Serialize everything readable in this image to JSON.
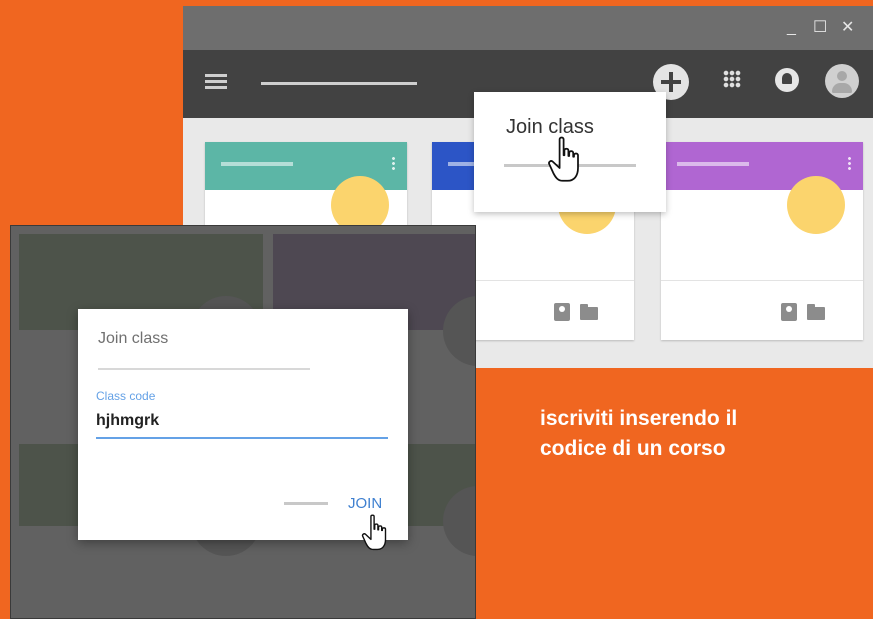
{
  "background_color": "#f06620",
  "back_window": {
    "controls": {
      "minimize": "_",
      "maximize": "☐",
      "close": "✕"
    },
    "cards": [
      {
        "header_color": "#5cb6a6"
      },
      {
        "header_color": "#2c55c6"
      },
      {
        "header_color": "#b066d2"
      }
    ],
    "dropdown": {
      "label": "Join class"
    }
  },
  "dialog": {
    "title": "Join class",
    "field_label": "Class code",
    "field_value": "hjhmgrk",
    "join_label": "JOIN",
    "accent_color": "#64a1e6"
  },
  "caption": {
    "line1": "iscriviti inserendo il",
    "line2": "codice di un corso"
  },
  "icons": [
    "hamburger-icon",
    "plus-icon",
    "apps-grid-icon",
    "bell-icon",
    "avatar-icon",
    "person-badge-icon",
    "folder-icon",
    "hand-cursor-icon"
  ]
}
